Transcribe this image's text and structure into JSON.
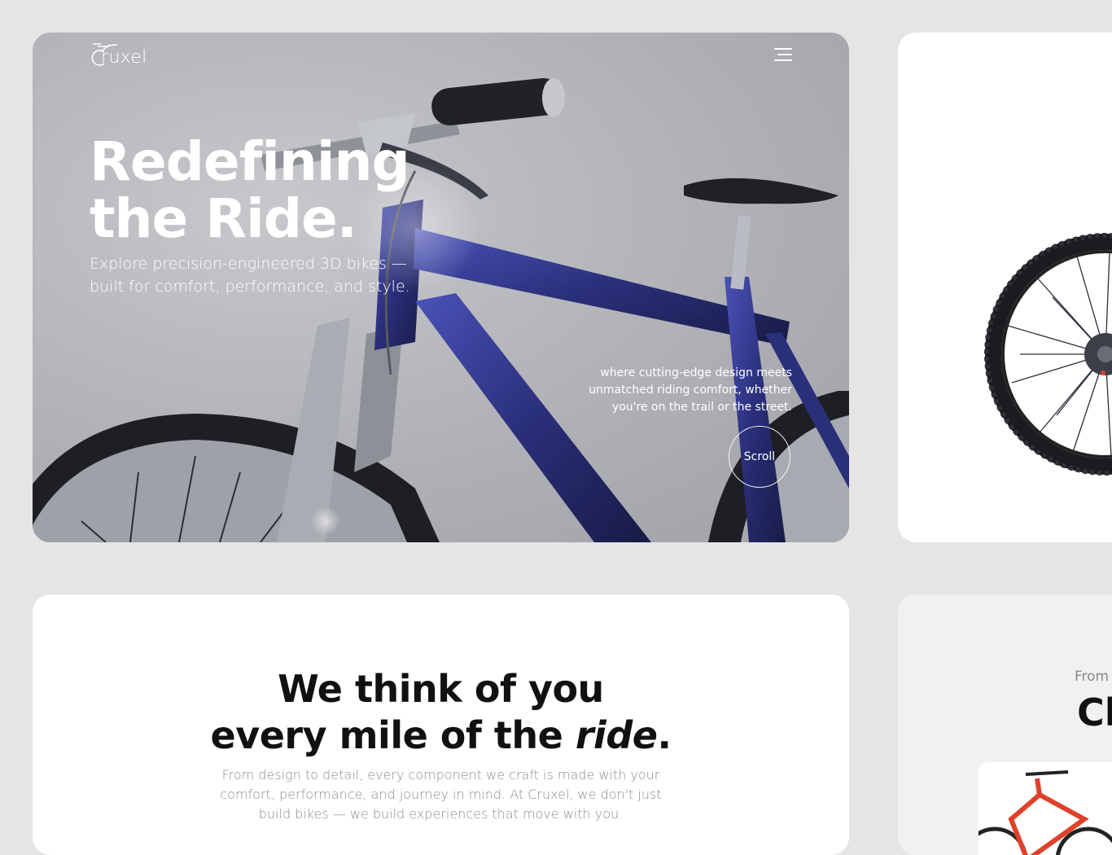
{
  "brand": {
    "name": "ruxel"
  },
  "nav": {
    "menu_icon": "hamburger-menu-icon"
  },
  "hero": {
    "title_line1": "Redefining",
    "title_line2": "the Ride.",
    "subtitle": "Explore precision-engineered 3D bikes — built for comfort, performance, and style.",
    "note": "where cutting-edge design meets unmatched riding comfort, whether you're on the trail or the street.",
    "scroll_label": "Scroll"
  },
  "about": {
    "title_line1": "We think of you",
    "title_line2_prefix": "every mile of the ",
    "title_line2_emph": "ride",
    "title_line2_suffix": ".",
    "body": "From design to detail, every component we craft is made with your comfort, performance, and journey in mind. At Cruxel, we don't just build bikes — we build experiences that move with you."
  },
  "collection": {
    "from_label": "From",
    "title": "Cl"
  },
  "colors": {
    "page_bg": "#e5e5e5",
    "card_bg": "#ffffff",
    "hero_text": "#ffffff",
    "heading": "#111111",
    "muted": "#8c8c8c",
    "frame_blue": "#2a2f7a",
    "accent_red": "#e0412a"
  }
}
